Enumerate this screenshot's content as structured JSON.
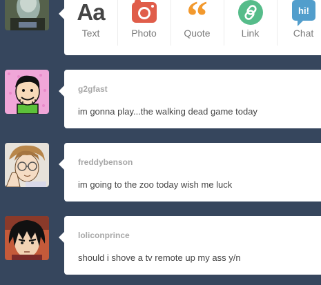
{
  "composer": {
    "post_types": [
      {
        "label": "Text",
        "icon": "text-post-icon",
        "glyph": "Aa",
        "color": "#444444"
      },
      {
        "label": "Photo",
        "icon": "camera-icon",
        "color": "#e05d4a"
      },
      {
        "label": "Quote",
        "icon": "quote-icon",
        "glyph": "“",
        "color": "#f2992e"
      },
      {
        "label": "Link",
        "icon": "link-icon",
        "color": "#56bc8a"
      },
      {
        "label": "Chat",
        "icon": "chat-bubble-icon",
        "glyph": "hi!",
        "color": "#529ecc"
      }
    ]
  },
  "feed": {
    "posts": [
      {
        "username": "g2gfast",
        "text": "im gonna play...the walking dead game today"
      },
      {
        "username": "freddybenson",
        "text": "im going to the zoo today wish me luck"
      },
      {
        "username": "loliconprince",
        "text": "should i shove a tv remote up my ass y/n"
      }
    ]
  },
  "colors": {
    "dashboard_background": "#36465d",
    "card_background": "#ffffff",
    "username": "#a7a7a7",
    "post_text": "#444444",
    "label_gray": "#7b7b7b"
  }
}
